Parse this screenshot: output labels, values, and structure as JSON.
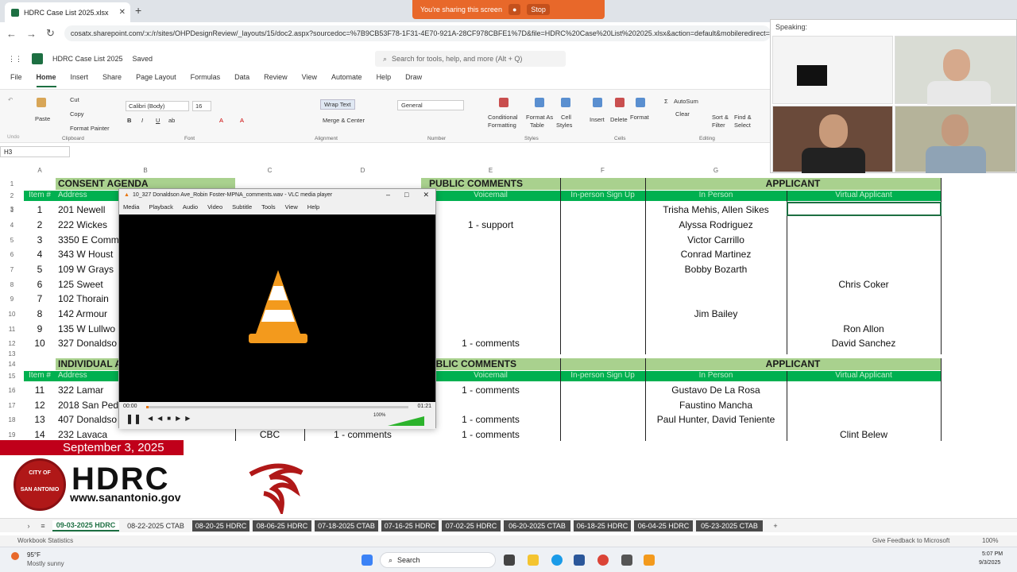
{
  "browser": {
    "tab_title": "HDRC Case List 2025.xlsx",
    "tab_close": "✕",
    "new_tab": "+",
    "address": "cosatx.sharepoint.com/:x:/r/sites/OHPDesignReview/_layouts/15/doc2.aspx?sourcedoc=%7B9CB53F78-1F31-4E70-921A-28CF978CBFE1%7D&file=HDRC%20Case%20List%202025.xlsx&action=default&mobileredirect=true",
    "share_text": "You're sharing this screen",
    "share_stop": "Stop"
  },
  "excel": {
    "file_title": "HDRC Case List 2025",
    "saved": "Saved",
    "search_placeholder": "Search for tools, help, and more (Alt + Q)",
    "menu": [
      "File",
      "Home",
      "Insert",
      "Share",
      "Page Layout",
      "Formulas",
      "Data",
      "Review",
      "View",
      "Automate",
      "Help",
      "Draw"
    ],
    "ribbon": {
      "undo": "Undo",
      "paste": "Paste",
      "cut": "Cut",
      "copy": "Copy",
      "format_painter": "Format Painter",
      "clipboard": "Clipboard",
      "font_name": "Calibri (Body)",
      "font_size": "16",
      "font_group": "Font",
      "wrap_text": "Wrap Text",
      "merge_center": "Merge & Center",
      "alignment": "Alignment",
      "number_format": "General",
      "number_group": "Number",
      "conditional": "Conditional",
      "formatting": "Formatting",
      "format_as": "Format As",
      "table": "Table",
      "cell": "Cell",
      "styles_small": "Styles",
      "styles": "Styles",
      "insert": "Insert",
      "delete": "Delete",
      "format": "Format",
      "cells": "Cells",
      "autosum": "AutoSum",
      "clear": "Clear",
      "sort_filter": "Sort &",
      "filter": "Filter",
      "find_select": "Find &",
      "select": "Select",
      "editing": "Editing"
    },
    "name_box": "H3",
    "col_letters": [
      "A",
      "B",
      "C",
      "D",
      "E",
      "F",
      "G"
    ],
    "sections": {
      "consent": "CONSENT AGENDA",
      "individual": "INDIVIDUAL A",
      "public_comments": "PUBLIC COMMENTS",
      "public_comments_2": "UBLIC COMMENTS",
      "applicant": "APPLICANT"
    },
    "headers": {
      "item": "Item #",
      "address": "Address",
      "voicemail": "Voicemail",
      "inperson_signup": "In-person Sign Up",
      "in_person": "In Person",
      "virtual": "Virtual Applicant"
    },
    "rows": [
      {
        "n": "1",
        "item": "1",
        "addr": "201 Newell",
        "c": "",
        "d": "",
        "vm": "",
        "in": "Trisha Mehis, Allen Sikes",
        "virt": ""
      },
      {
        "n": "4",
        "item": "2",
        "addr": "222 Wickes",
        "c": "",
        "d": "",
        "vm": "1 - support",
        "in": "Alyssa Rodriguez",
        "virt": ""
      },
      {
        "n": "5",
        "item": "3",
        "addr": "3350 E Comm",
        "c": "",
        "d": "",
        "vm": "",
        "in": "Victor Carrillo",
        "virt": ""
      },
      {
        "n": "6",
        "item": "4",
        "addr": "343 W Houst",
        "c": "",
        "d": "",
        "vm": "",
        "in": "Conrad Martinez",
        "virt": ""
      },
      {
        "n": "7",
        "item": "5",
        "addr": "109 W Grays",
        "c": "",
        "d": "",
        "vm": "",
        "in": "Bobby Bozarth",
        "virt": ""
      },
      {
        "n": "8",
        "item": "6",
        "addr": "125 Sweet",
        "c": "",
        "d": "",
        "vm": "",
        "in": "",
        "virt": "Chris Coker"
      },
      {
        "n": "9",
        "item": "7",
        "addr": "102 Thorain",
        "c": "",
        "d": "",
        "vm": "",
        "in": "",
        "virt": ""
      },
      {
        "n": "10",
        "item": "8",
        "addr": "142 Armour",
        "c": "",
        "d": "",
        "vm": "",
        "in": "Jim Bailey",
        "virt": ""
      },
      {
        "n": "11",
        "item": "9",
        "addr": "135 W Lullwo",
        "c": "",
        "d": "",
        "vm": "",
        "in": "",
        "virt": "Ron Allon"
      },
      {
        "n": "12",
        "item": "10",
        "addr": "327 Donaldso",
        "c": "",
        "d": "",
        "vm": "1 - comments",
        "in": "",
        "virt": "David Sanchez"
      },
      {
        "n": "16",
        "item": "11",
        "addr": "322 Lamar",
        "c": "",
        "d": "",
        "vm": "1 - comments",
        "in": "Gustavo De La Rosa",
        "virt": ""
      },
      {
        "n": "17",
        "item": "12",
        "addr": "2018 San Ped",
        "c": "",
        "d": "",
        "vm": "",
        "in": "Faustino Mancha",
        "virt": ""
      },
      {
        "n": "18",
        "item": "13",
        "addr": "407 Donaldso",
        "c": "",
        "d": "",
        "vm": "1 - comments",
        "in": "Paul Hunter, David Teniente",
        "virt": ""
      },
      {
        "n": "19",
        "item": "14",
        "addr": "232 Lavaca",
        "c": "CBC",
        "d": "1 - comments",
        "vm": "1 - comments",
        "in": "",
        "virt": "Clint Belew"
      }
    ],
    "row_labels": {
      "r2": "2",
      "r3": "3",
      "r13": "13",
      "r14": "14",
      "r15": "15",
      "r1": "1"
    },
    "sheet_tabs": [
      "09-03-2025 HDRC",
      "08-22-2025 CTAB",
      "08-20-25 HDRC",
      "08-06-25 HDRC",
      "07-18-2025 CTAB",
      "07-16-25 HDRC",
      "07-02-25 HDRC",
      "06-20-2025 CTAB",
      "06-18-25 HDRC",
      "06-04-25 HDRC",
      "05-23-2025 CTAB"
    ],
    "status_left": "Workbook Statistics",
    "status_feedback": "Give Feedback to Microsoft",
    "zoom": "100%"
  },
  "vlc": {
    "title": "10_327 Donaldson Ave_Robin Foster-MPNA_comments.wav - VLC media player",
    "menu": [
      "Media",
      "Playback",
      "Audio",
      "Video",
      "Subtitle",
      "Tools",
      "View",
      "Help"
    ],
    "time_current": "00:00",
    "time_total": "01:21",
    "volume": "100%",
    "progress": 0.01
  },
  "meeting": {
    "speaking": "Speaking:"
  },
  "overlay": {
    "date": "September 3, 2025",
    "seal_top": "CITY OF",
    "seal_name": "SAN ANTONIO",
    "org": "HDRC",
    "url": "www.sanantonio.gov"
  },
  "taskbar": {
    "weather_temp": "95°F",
    "weather_desc": "Mostly sunny",
    "search": "Search",
    "time": "5:07 PM",
    "date": "9/3/2025"
  },
  "colors": {
    "excel_green": "#1d6f42",
    "section_green": "#a9d18e",
    "header_green": "#00b050",
    "banner_red": "#c0001a",
    "share_orange": "#e8682a"
  }
}
